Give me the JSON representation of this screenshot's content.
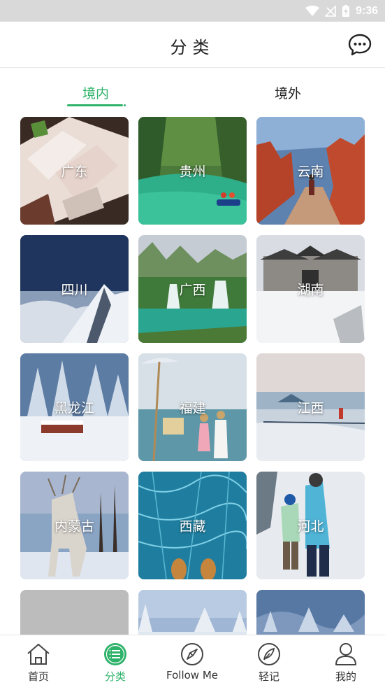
{
  "status_bar": {
    "time": "9:36"
  },
  "header": {
    "title": "分类"
  },
  "tabs": [
    {
      "label": "境内",
      "active": true
    },
    {
      "label": "境外",
      "active": false
    }
  ],
  "regions": [
    {
      "name": "广东",
      "scene": "food"
    },
    {
      "name": "贵州",
      "scene": "river"
    },
    {
      "name": "云南",
      "scene": "canyon"
    },
    {
      "name": "四川",
      "scene": "snow-peak"
    },
    {
      "name": "广西",
      "scene": "waterfall"
    },
    {
      "name": "湖南",
      "scene": "snow-town"
    },
    {
      "name": "黑龙江",
      "scene": "snow-forest"
    },
    {
      "name": "福建",
      "scene": "beach"
    },
    {
      "name": "江西",
      "scene": "frost-mountain"
    },
    {
      "name": "内蒙古",
      "scene": "reindeer"
    },
    {
      "name": "西藏",
      "scene": "ice-lake"
    },
    {
      "name": "河北",
      "scene": "ski"
    },
    {
      "name": "",
      "scene": "blank"
    },
    {
      "name": "",
      "scene": "snow-trees"
    },
    {
      "name": "",
      "scene": "frozen-forest"
    }
  ],
  "bottom_nav": [
    {
      "label": "首页",
      "icon": "home-icon",
      "active": false
    },
    {
      "label": "分类",
      "icon": "list-icon",
      "active": true
    },
    {
      "label": "Follow Me",
      "icon": "compass-icon",
      "active": false
    },
    {
      "label": "轻记",
      "icon": "feather-icon",
      "active": false
    },
    {
      "label": "我的",
      "icon": "user-icon",
      "active": false
    }
  ],
  "colors": {
    "accent": "#2fb36b",
    "status_bar": "#d9d9d9"
  }
}
